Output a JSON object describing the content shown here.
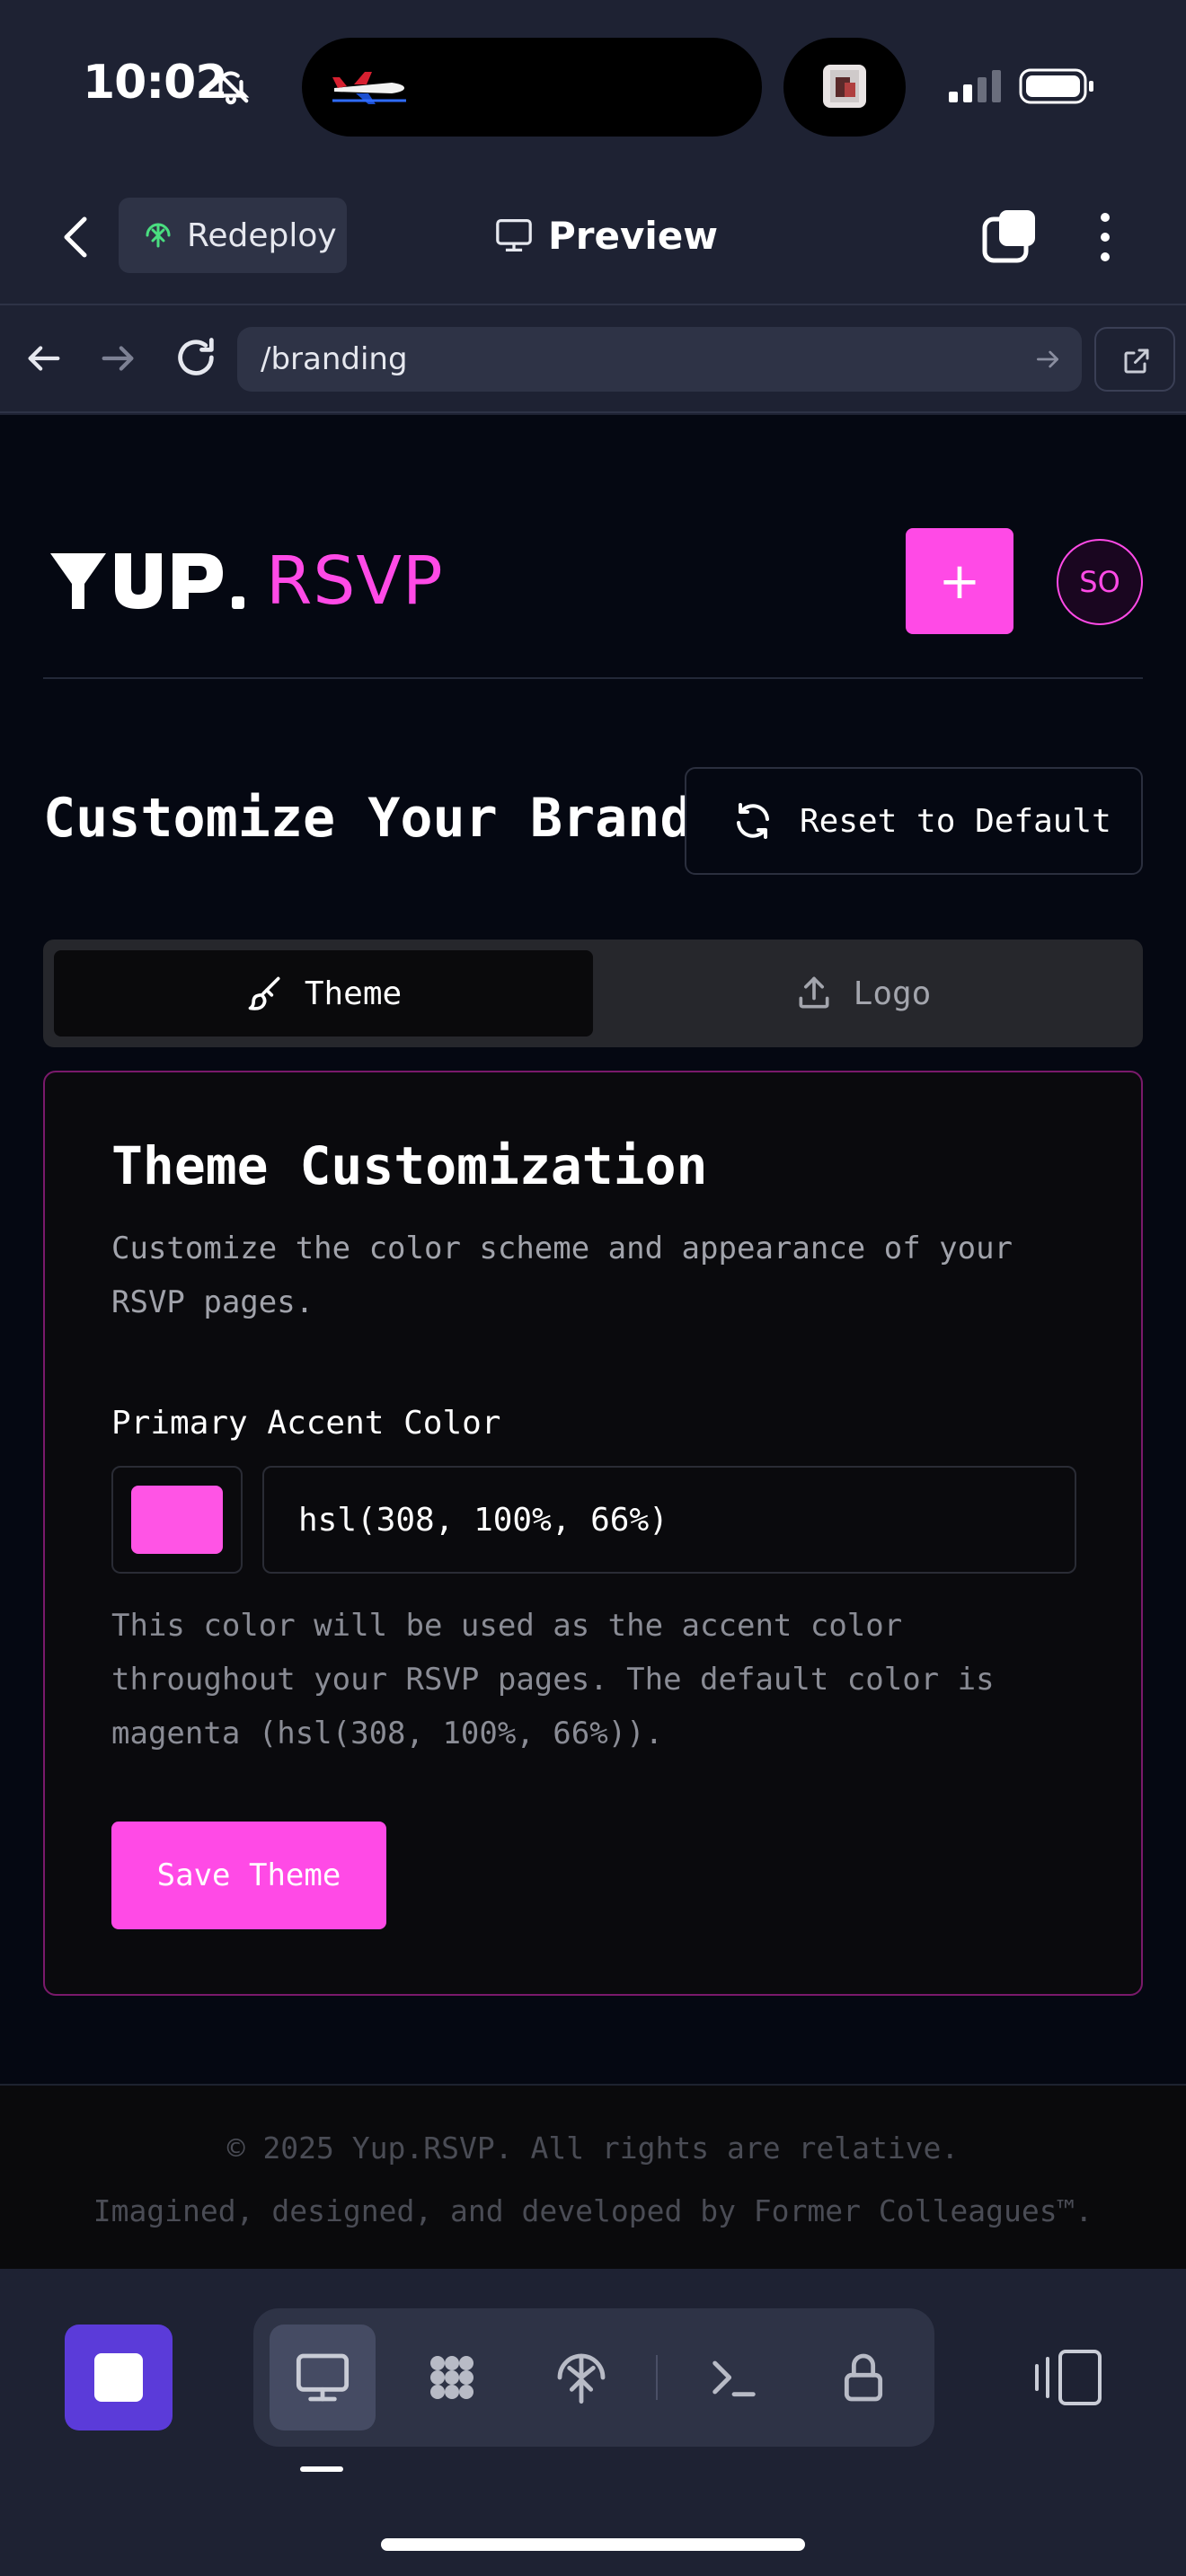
{
  "status_bar": {
    "time": "10:02"
  },
  "app_header": {
    "redeploy_label": "Redeploy",
    "title": "Preview"
  },
  "browser": {
    "url": "/branding"
  },
  "site": {
    "brand_wordmark": "YUP.",
    "brand_suffix": "RSVP",
    "new_button": "+",
    "avatar_initials": "SO"
  },
  "page": {
    "title": "Customize Your Brand",
    "reset_button": "Reset to Default",
    "tabs": [
      {
        "label": "Theme",
        "icon": "paintbrush-icon",
        "active": true
      },
      {
        "label": "Logo",
        "icon": "upload-icon",
        "active": false
      }
    ],
    "card": {
      "title": "Theme Customization",
      "description": "Customize the color scheme and appearance of your RSVP pages.",
      "field_label": "Primary Accent Color",
      "color_value": "hsl(308, 100%, 66%)",
      "help_text": "This color will be used as the accent color throughout your RSVP pages. The default color is magenta (hsl(308, 100%, 66%)).",
      "save_button": "Save Theme"
    },
    "footer": {
      "copyright": "© 2025 Yup.RSVP. All rights are relative.",
      "credit": "Imagined, designed, and developed by Former Colleagues™."
    }
  },
  "colors": {
    "accent": "#ff4ae6",
    "background": "#050812",
    "chrome": "#1e2233",
    "stop_button": "#5b3bd9"
  },
  "toolbar": {
    "tools": [
      "monitor-icon",
      "apps-grid-icon",
      "deploy-icon",
      "terminal-icon",
      "lock-icon"
    ],
    "active_tool": "monitor-icon"
  }
}
